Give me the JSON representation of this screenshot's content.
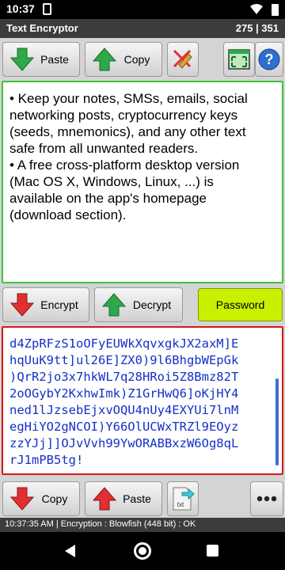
{
  "status_bar": {
    "time": "10:37"
  },
  "title_bar": {
    "title": "Text Encryptor",
    "counter": "275 | 351"
  },
  "top_toolbar": {
    "paste_label": "Paste",
    "copy_label": "Copy"
  },
  "plain_text": {
    "value": "• Keep your notes, SMSs, emails, social\nnetworking posts, cryptocurrency keys\n(seeds, mnemonics), and any other text\nsafe from all unwanted readers.\n• A free cross-platform desktop version\n(Mac OS X, Windows, Linux, ...) is\navailable on the app's homepage\n(download section)."
  },
  "middle_toolbar": {
    "encrypt_label": "Encrypt",
    "decrypt_label": "Decrypt",
    "password_label": "Password"
  },
  "cipher_text": {
    "value": "d4ZpRFzS1oOFyEUWkXqvxgkJX2axM]E\nhqUuK9tt]ul26E]ZX0)9l6BhgbWEpGk\n)QrR2jo3x7hkWL7q28HRoi5Z8Bmz82T\n2oOGybY2KxhwImk)Z1GrHwQ6]oKjHY4\nned1lJzsebEjxvOQU4nUy4EXYUi7lnM\negHiYO2gNCOI)Y66OlUCWxTRZl9EOyz\nzzYJj]]OJvVvh99YwORABBxzW6Og8qL\nrJ1mPB5tg!"
  },
  "bottom_toolbar": {
    "copy_label": "Copy",
    "paste_label": "Paste",
    "txt_label": "txt"
  },
  "status_footer": {
    "text": "10:37:35 AM | Encryption : Blowfish (448 bit) : OK"
  },
  "colors": {
    "plain_border": "#3cc43c",
    "cipher_border": "#d81818",
    "cipher_text": "#1430c8",
    "password_button": "#c8f000",
    "arrow_green": "#2fa84a",
    "arrow_red": "#e03030"
  }
}
